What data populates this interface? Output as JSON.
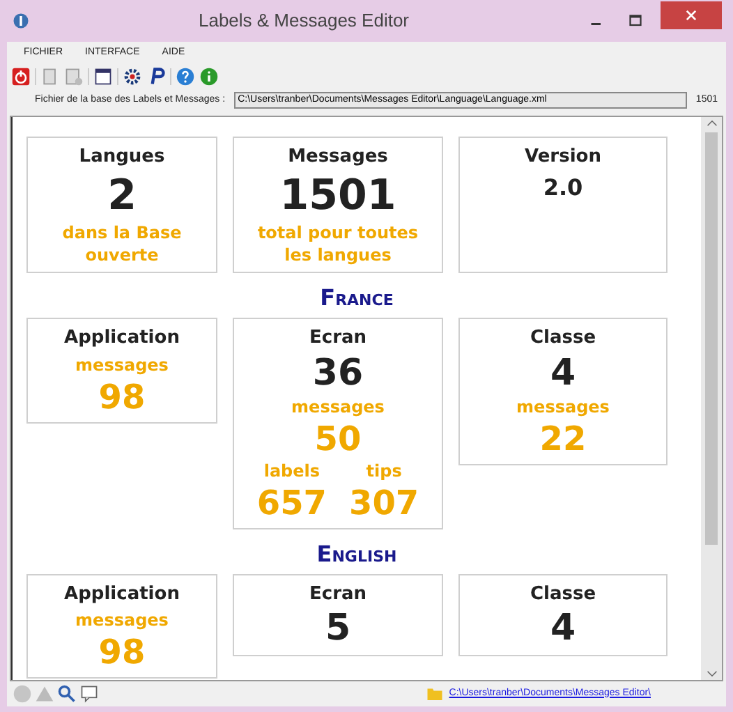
{
  "window": {
    "title": "Labels & Messages Editor"
  },
  "menu": [
    "FICHIER",
    "INTERFACE",
    "AIDE"
  ],
  "file_bar": {
    "label": "Fichier de la base des Labels et Messages :",
    "value": "C:\\Users\\tranber\\Documents\\Messages Editor\\Language\\Language.xml",
    "count": "1501"
  },
  "summary": [
    {
      "kind": "count",
      "title": "Langues",
      "value": "2",
      "caption": "dans la Base ouverte"
    },
    {
      "kind": "count",
      "title": "Messages",
      "value": "1501",
      "caption": "total pour toutes les langues"
    },
    {
      "kind": "version",
      "title": "Version",
      "value": "2.0"
    }
  ],
  "languages": [
    {
      "name": "France",
      "cards": [
        {
          "title": "Application",
          "stats": [
            {
              "label": "messages",
              "value": "98"
            }
          ]
        },
        {
          "title": "Ecran",
          "value": "36",
          "stats": [
            {
              "label": "messages",
              "value": "50"
            }
          ],
          "pairs": [
            {
              "label": "labels",
              "value": "657"
            },
            {
              "label": "tips",
              "value": "307"
            }
          ]
        },
        {
          "title": "Classe",
          "value": "4",
          "stats": [
            {
              "label": "messages",
              "value": "22"
            }
          ]
        }
      ]
    },
    {
      "name": "English",
      "cards": [
        {
          "title": "Application",
          "stats": [
            {
              "label": "messages",
              "value": "98"
            }
          ]
        },
        {
          "title": "Ecran",
          "value": "5"
        },
        {
          "title": "Classe",
          "value": "4"
        }
      ]
    }
  ],
  "status_bar": {
    "path": "C:\\Users\\tranber\\Documents\\Messages Editor\\"
  }
}
